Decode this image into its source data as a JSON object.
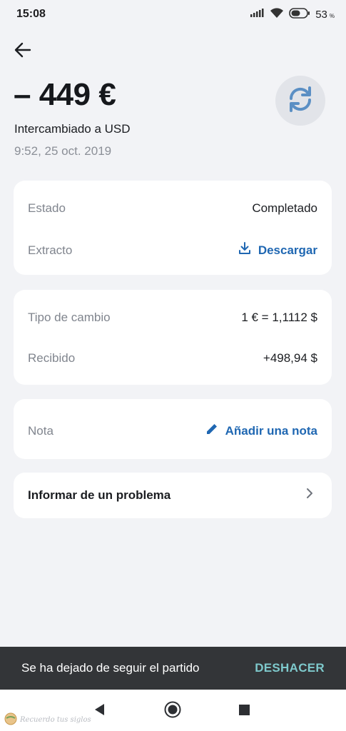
{
  "status_bar": {
    "time": "15:08",
    "battery_level": "53",
    "battery_unit": "%",
    "icons": [
      "signal-icon",
      "wifi-icon",
      "battery-icon"
    ]
  },
  "header": {
    "back_icon": "arrow-left-icon",
    "amount": "– 449 €",
    "subtitle": "Intercambiado a USD",
    "datetime": "9:52, 25 oct. 2019",
    "exchange_icon": "refresh-icon"
  },
  "status_card": {
    "state_label": "Estado",
    "state_value": "Completado",
    "statement_label": "Extracto",
    "statement_action": "Descargar"
  },
  "exchange_card": {
    "rate_label": "Tipo de cambio",
    "rate_value": "1 € = 1,1112 $",
    "received_label": "Recibido",
    "received_value": "+498,94 $"
  },
  "note_card": {
    "note_label": "Nota",
    "note_action": "Añadir una nota"
  },
  "problem_card": {
    "label": "Informar de un problema"
  },
  "snackbar": {
    "message": "Se ha dejado de seguir el partido",
    "action": "DESHACER"
  },
  "watermark": {
    "text": "Recuerdo tus siglos"
  },
  "colors": {
    "background": "#f2f3f6",
    "accent": "#1f67b2",
    "muted": "#80858e",
    "snackbar_bg": "#333538",
    "snackbar_action": "#7ec9cc"
  }
}
